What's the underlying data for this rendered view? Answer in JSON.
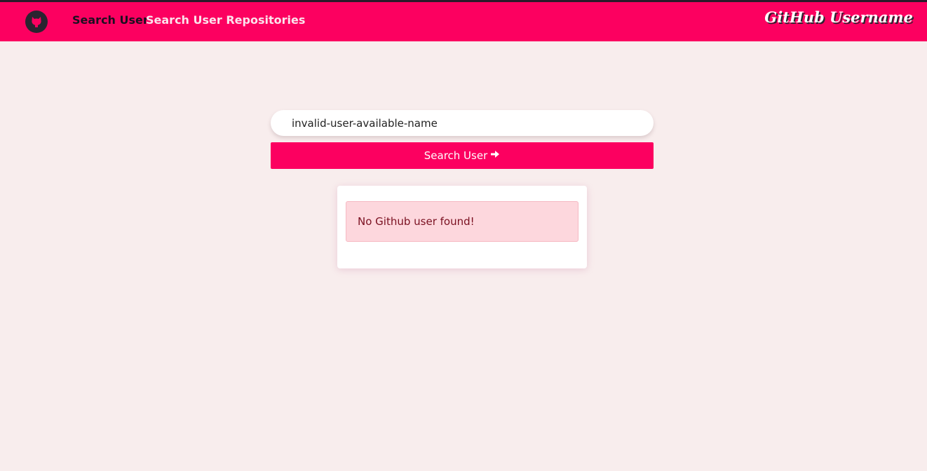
{
  "nav": {
    "links": [
      {
        "label": "Search User",
        "active": true
      },
      {
        "label": "Search User Repositories",
        "active": false
      }
    ],
    "brand": "GitHub Username"
  },
  "search": {
    "value": "invalid-user-available-name",
    "button_label": "Search User"
  },
  "result": {
    "message": "No Github user found!"
  },
  "colors": {
    "primary": "#fc0060",
    "background": "#f8eded",
    "alert_bg": "#fdd7dd",
    "alert_text": "#7a1020"
  },
  "icons": {
    "logo": "github-icon",
    "button": "arrow-right-icon"
  }
}
